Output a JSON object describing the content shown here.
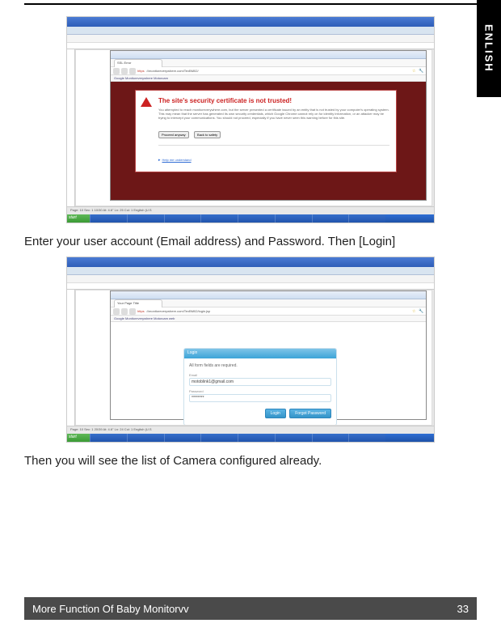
{
  "side_tab": "ENLISH",
  "paragraphs": {
    "instr1": "Enter your user account (Email address) and Password.  Then [Login]",
    "instr2": "Then you will see the list of Camera configured already."
  },
  "screenshot1": {
    "tab_label": "SSL Error",
    "url_warn": "https",
    "url": "://monitoreverywhere.com/TexBM02/",
    "bookmarks": "Google   Monitoreverywhere   Motorcam",
    "warning": {
      "title": "The site's security certificate is not trusted!",
      "text": "You attempted to reach monitoreverywhere.com, but the server presented a certificate issued by an entity that is not trusted by your computer's operating system. This may mean that the server has generated its own security credentials, which Google Chrome cannot rely on for identity information, or an attacker may be trying to intercept your communications. You should not proceed, especially if you have never seen this warning before for this site.",
      "btn_proceed": "Proceed anyway",
      "btn_back": "Back to safety",
      "help": "Help me understand"
    },
    "status": "Page: 10   Sec: 1    10/30    At: 4.6\"   Ln: 25   Col: 1        English (U.S",
    "taskbar_start": "start"
  },
  "screenshot2": {
    "tab_label": "Your Page Title",
    "url_warn": "https",
    "url": "://monitoreverywhere.com/TexBM02/login.jsp",
    "bookmarks": "Google   Monitoreverywhere   Motorcam   web",
    "login": {
      "header": "Login",
      "required_msg": "All form fields are required.",
      "email_label": "Email",
      "email_value": "motoblink1@gmail.com",
      "password_label": "Password",
      "password_value": "********",
      "btn_login": "Login",
      "btn_forgot": "Forgot Password"
    },
    "status": "Page: 10   Sec: 1    20/39    At: 4.6\"   Ln: 24   Col: 1        English (U.S",
    "taskbar_start": "start"
  },
  "footer": {
    "section": "More Function Of Baby Monitorvv",
    "page_number": "33"
  }
}
